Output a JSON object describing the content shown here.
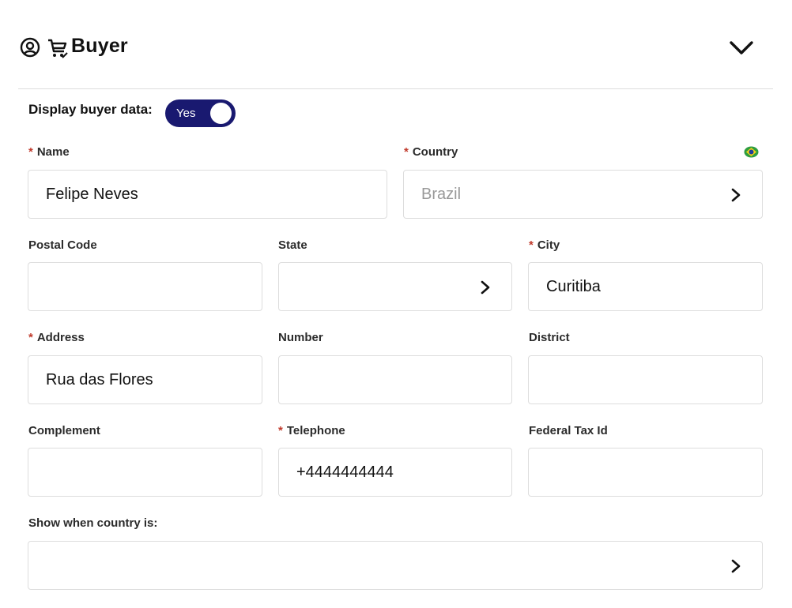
{
  "header": {
    "title": "Buyer",
    "icons": [
      "user-circle-icon",
      "cart-icon",
      "chevron-down-icon"
    ]
  },
  "display": {
    "label": "Display buyer data:",
    "toggle_text": "Yes",
    "enabled": true
  },
  "fields": {
    "name": {
      "label": "Name",
      "required": "*",
      "value": "Felipe Neves"
    },
    "country": {
      "label": "Country",
      "required": "*",
      "value": "Brazil",
      "flag_icon": "brazil-flag-icon"
    },
    "postal_code": {
      "label": "Postal Code",
      "value": ""
    },
    "state": {
      "label": "State",
      "value": ""
    },
    "city": {
      "label": "City",
      "required": "*",
      "value": "Curitiba"
    },
    "address": {
      "label": "Address",
      "required": "*",
      "value": "Rua das Flores"
    },
    "number": {
      "label": "Number",
      "value": ""
    },
    "district": {
      "label": "District",
      "value": ""
    },
    "complement": {
      "label": "Complement",
      "value": ""
    },
    "telephone": {
      "label": "Telephone",
      "required": "*",
      "value": "+4444444444"
    },
    "federal_tax_id": {
      "label": "Federal Tax Id",
      "value": ""
    },
    "show_when_country": {
      "label": "Show when country is:",
      "value": ""
    }
  },
  "colors": {
    "accent": "#191970",
    "required": "#c0392b",
    "border": "#dddddd"
  }
}
